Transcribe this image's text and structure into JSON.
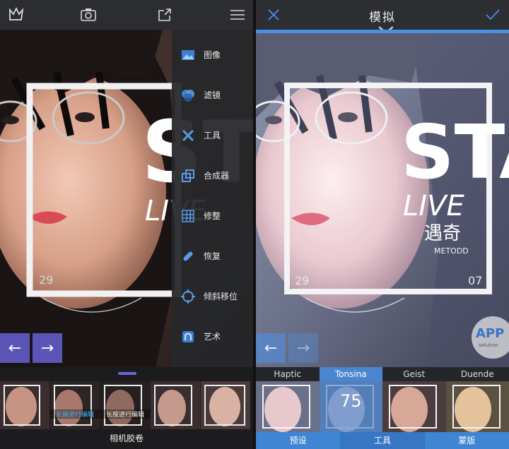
{
  "left": {
    "menu": [
      {
        "label": "图像",
        "icon": "image-icon"
      },
      {
        "label": "滤镜",
        "icon": "filter-icon"
      },
      {
        "label": "工具",
        "icon": "tools-icon"
      },
      {
        "label": "合成器",
        "icon": "compositor-icon"
      },
      {
        "label": "修整",
        "icon": "adjust-icon"
      },
      {
        "label": "恢复",
        "icon": "heal-icon"
      },
      {
        "label": "倾斜移位",
        "icon": "tilt-shift-icon"
      },
      {
        "label": "艺术",
        "icon": "art-icon"
      }
    ],
    "arrows": {
      "prev": "←",
      "next": "→"
    },
    "thumb_captions": [
      "长按进行编辑",
      "长按进行编辑"
    ],
    "bottom_label": "相机胶卷"
  },
  "photo_text": {
    "big": "STA",
    "live": "LIVE",
    "cn": "遇奇",
    "sub": "METODD",
    "num_left": "29",
    "num_right": "07"
  },
  "right": {
    "title": "模拟",
    "filters": [
      {
        "name": "Haptic"
      },
      {
        "name": "Tonsina",
        "value": "75"
      },
      {
        "name": "Geist"
      },
      {
        "name": "Duende"
      }
    ],
    "tabs": [
      "预设",
      "工具",
      "蒙版"
    ],
    "watermark": {
      "main": "APP",
      "sub": "solution"
    }
  },
  "colors": {
    "accent_blue": "#4a90e2",
    "accent_purple": "#5b55b8",
    "caption_blue": "#45b8ff"
  }
}
